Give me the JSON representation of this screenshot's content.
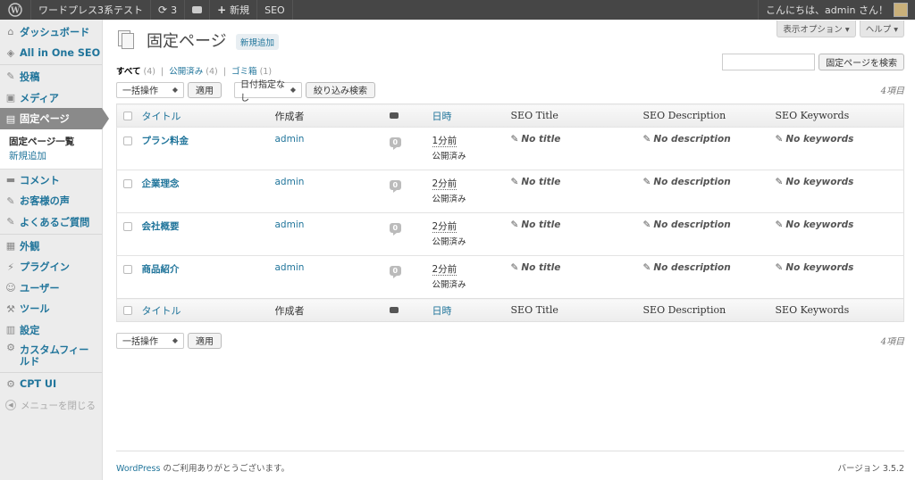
{
  "adminbar": {
    "site_name": "ワードプレス3系テスト",
    "updates_count": "3",
    "new_label": "新規",
    "seo_label": "SEO",
    "greeting": "こんにちは、admin さん！"
  },
  "sidebar": {
    "items": [
      {
        "label": "ダッシュボード",
        "icon": "⌂"
      },
      {
        "label": "All in One SEO",
        "icon": "◈"
      },
      {
        "label": "投稿",
        "icon": "✎"
      },
      {
        "label": "メディア",
        "icon": "▣"
      },
      {
        "label": "固定ページ",
        "icon": "▤"
      },
      {
        "label": "コメント",
        "icon": "▬"
      },
      {
        "label": "お客様の声",
        "icon": "✎"
      },
      {
        "label": "よくあるご質問",
        "icon": "✎"
      },
      {
        "label": "外観",
        "icon": "▦"
      },
      {
        "label": "プラグイン",
        "icon": "⚡"
      },
      {
        "label": "ユーザー",
        "icon": "☺"
      },
      {
        "label": "ツール",
        "icon": "⚒"
      },
      {
        "label": "設定",
        "icon": "▥"
      },
      {
        "label": "カスタムフィールド",
        "icon": "⚙"
      },
      {
        "label": "CPT UI",
        "icon": "⚙"
      }
    ],
    "submenu": {
      "current": "固定ページ一覧",
      "add_new": "新規追加"
    },
    "collapse_label": "メニューを閉じる"
  },
  "header": {
    "title": "固定ページ",
    "add_new": "新規追加",
    "screen_options": "表示オプション ▾",
    "help": "ヘルプ ▾"
  },
  "filters": {
    "all_label": "すべて",
    "all_count": "(4)",
    "published_label": "公開済み",
    "published_count": "(4)",
    "trash_label": "ゴミ箱",
    "trash_count": "(1)",
    "sep": "|"
  },
  "search": {
    "button": "固定ページを検索"
  },
  "tablenav": {
    "bulk_action": "一括操作",
    "apply": "適用",
    "date_filter": "日付指定なし",
    "filter_button": "絞り込み検索",
    "items_count": "4項目"
  },
  "table": {
    "columns": {
      "title": "タイトル",
      "author": "作成者",
      "date": "日時",
      "seo_title": "SEO Title",
      "seo_description": "SEO Description",
      "seo_keywords": "SEO Keywords"
    },
    "rows": [
      {
        "title": "プラン料金",
        "author": "admin",
        "comments": "0",
        "date": "1分前",
        "status": "公開済み",
        "seo_title": "No title",
        "seo_description": "No description",
        "seo_keywords": "No keywords"
      },
      {
        "title": "企業理念",
        "author": "admin",
        "comments": "0",
        "date": "2分前",
        "status": "公開済み",
        "seo_title": "No title",
        "seo_description": "No description",
        "seo_keywords": "No keywords"
      },
      {
        "title": "会社概要",
        "author": "admin",
        "comments": "0",
        "date": "2分前",
        "status": "公開済み",
        "seo_title": "No title",
        "seo_description": "No description",
        "seo_keywords": "No keywords"
      },
      {
        "title": "商品紹介",
        "author": "admin",
        "comments": "0",
        "date": "2分前",
        "status": "公開済み",
        "seo_title": "No title",
        "seo_description": "No description",
        "seo_keywords": "No keywords"
      }
    ]
  },
  "footer": {
    "wp_link": "WordPress",
    "thanks": " のご利用ありがとうございます。",
    "version": "バージョン 3.5.2"
  }
}
